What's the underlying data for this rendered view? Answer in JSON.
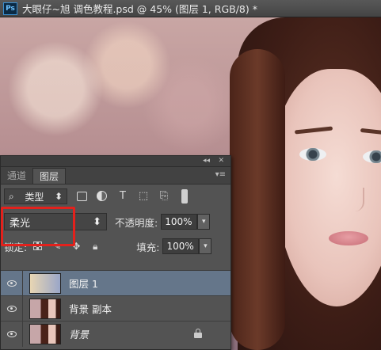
{
  "window": {
    "title": "大眼仔~旭 调色教程.psd @ 45% (图层 1, RGB/8) *",
    "app_icon": "Ps"
  },
  "panel": {
    "tabs": [
      "通道",
      "图层"
    ],
    "active_tab": "图层",
    "filter": {
      "label": "类型",
      "icon": "search-icon"
    },
    "blend_mode": "柔光",
    "opacity_label": "不透明度:",
    "opacity_value": "100%",
    "lock_label": "锁定:",
    "fill_label": "填充:",
    "fill_value": "100%",
    "layers": [
      {
        "name": "图层 1",
        "selected": true,
        "visible": true,
        "locked": false
      },
      {
        "name": "背景 副本",
        "selected": false,
        "visible": true,
        "locked": false
      },
      {
        "name": "背景",
        "selected": false,
        "visible": true,
        "locked": true
      }
    ]
  },
  "colors": {
    "highlight": "#65768a",
    "annotation_red": "#e3211c",
    "panel_bg": "#535353"
  }
}
